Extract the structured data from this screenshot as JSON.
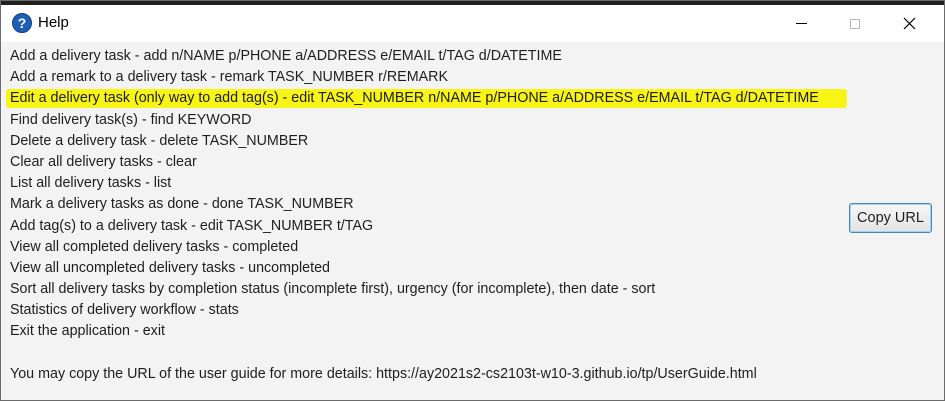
{
  "window": {
    "title": "Help",
    "icon": "question-icon",
    "controls": [
      "minimize-icon",
      "maximize-icon",
      "close-icon"
    ]
  },
  "colors": {
    "highlight": "#f7f416",
    "title_icon": "#1d5fb7",
    "button_border": "#3c8ac5"
  },
  "commands": [
    "Add a delivery task - add n/NAME p/PHONE a/ADDRESS e/EMAIL t/TAG d/DATETIME",
    "Add a remark to a delivery task - remark TASK_NUMBER r/REMARK",
    "Edit a delivery task (only way to add tag(s) - edit TASK_NUMBER n/NAME p/PHONE a/ADDRESS e/EMAIL t/TAG d/DATETIME",
    "Find delivery task(s) - find KEYWORD",
    "Delete a delivery task - delete TASK_NUMBER",
    "Clear all delivery tasks - clear",
    "List all delivery tasks - list",
    "Mark a delivery tasks as done - done TASK_NUMBER",
    "Add tag(s) to a delivery task - edit TASK_NUMBER t/TAG",
    "View all completed delivery tasks - completed",
    "View all uncompleted delivery tasks - uncompleted",
    "Sort all delivery tasks by completion status (incomplete first), urgency (for incomplete), then date - sort",
    "Statistics of delivery workflow - stats",
    "Exit the application - exit"
  ],
  "footer": {
    "text": "You may copy the URL of the user guide for more details: https://ay2021s2-cs2103t-w10-3.github.io/tp/UserGuide.html"
  },
  "copy_button": {
    "label": "Copy URL"
  }
}
